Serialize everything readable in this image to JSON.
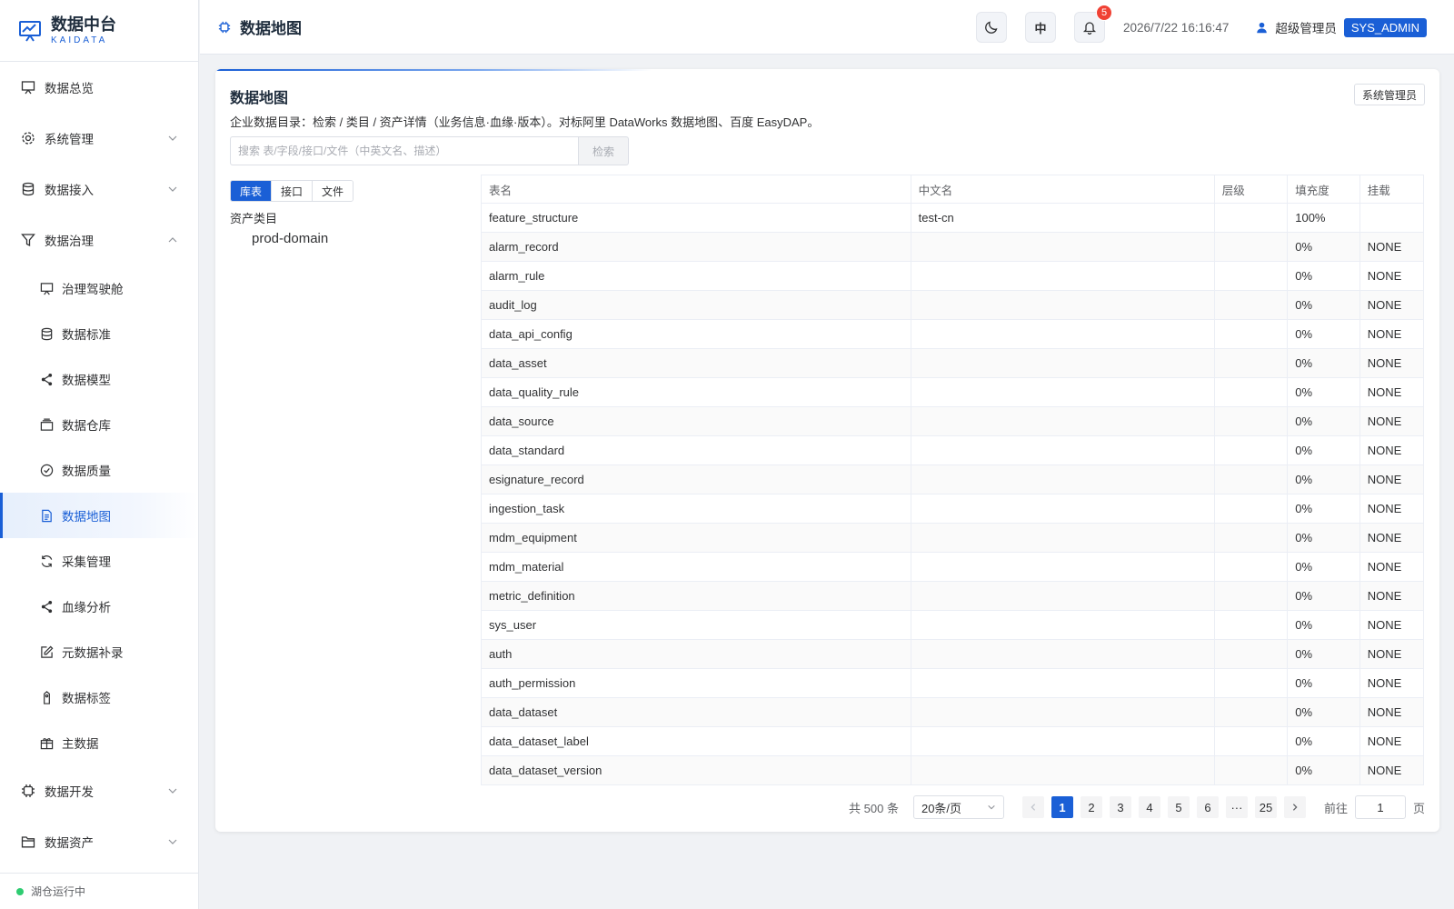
{
  "brand": {
    "title": "数据中台",
    "subtitle": "KAIDATA",
    "accent": "#1a5fd6"
  },
  "sidebar": {
    "items": [
      {
        "label": "数据总览"
      },
      {
        "label": "系统管理"
      },
      {
        "label": "数据接入"
      },
      {
        "label": "数据治理"
      }
    ],
    "sub_items": [
      {
        "label": "治理驾驶舱"
      },
      {
        "label": "数据标准"
      },
      {
        "label": "数据模型"
      },
      {
        "label": "数据仓库"
      },
      {
        "label": "数据质量"
      },
      {
        "label": "数据地图"
      },
      {
        "label": "采集管理"
      },
      {
        "label": "血缘分析"
      },
      {
        "label": "元数据补录"
      },
      {
        "label": "数据标签"
      },
      {
        "label": "主数据"
      }
    ],
    "bottom_items": [
      {
        "label": "数据开发"
      },
      {
        "label": "数据资产"
      }
    ],
    "footer_status": "湖仓运行中",
    "status_color": "#2ecc71"
  },
  "header": {
    "page_title": "数据地图",
    "lang_label": "中",
    "notification_count": "5",
    "datetime": "2026/7/22 16:16:47",
    "user_name": "超级管理员",
    "role": "SYS_ADMIN"
  },
  "card": {
    "title": "数据地图",
    "description": "企业数据目录：检索 / 类目 / 资产详情（业务信息·血缘·版本）。对标阿里 DataWorks 数据地图、百度 EasyDAP。",
    "admin_button": "系统管理员",
    "search_placeholder": "搜索 表/字段/接口/文件（中英文名、描述）",
    "search_button": "检索",
    "tabs": [
      "库表",
      "接口",
      "文件"
    ],
    "tree_title": "资产类目",
    "tree_node": "prod-domain"
  },
  "table": {
    "columns": [
      "表名",
      "中文名",
      "层级",
      "填充度",
      "挂载"
    ],
    "rows": [
      [
        "feature_structure",
        "test-cn",
        "",
        "100%",
        ""
      ],
      [
        "alarm_record",
        "",
        "",
        "0%",
        "NONE"
      ],
      [
        "alarm_rule",
        "",
        "",
        "0%",
        "NONE"
      ],
      [
        "audit_log",
        "",
        "",
        "0%",
        "NONE"
      ],
      [
        "data_api_config",
        "",
        "",
        "0%",
        "NONE"
      ],
      [
        "data_asset",
        "",
        "",
        "0%",
        "NONE"
      ],
      [
        "data_quality_rule",
        "",
        "",
        "0%",
        "NONE"
      ],
      [
        "data_source",
        "",
        "",
        "0%",
        "NONE"
      ],
      [
        "data_standard",
        "",
        "",
        "0%",
        "NONE"
      ],
      [
        "esignature_record",
        "",
        "",
        "0%",
        "NONE"
      ],
      [
        "ingestion_task",
        "",
        "",
        "0%",
        "NONE"
      ],
      [
        "mdm_equipment",
        "",
        "",
        "0%",
        "NONE"
      ],
      [
        "mdm_material",
        "",
        "",
        "0%",
        "NONE"
      ],
      [
        "metric_definition",
        "",
        "",
        "0%",
        "NONE"
      ],
      [
        "sys_user",
        "",
        "",
        "0%",
        "NONE"
      ],
      [
        "auth",
        "",
        "",
        "0%",
        "NONE"
      ],
      [
        "auth_permission",
        "",
        "",
        "0%",
        "NONE"
      ],
      [
        "data_dataset",
        "",
        "",
        "0%",
        "NONE"
      ],
      [
        "data_dataset_label",
        "",
        "",
        "0%",
        "NONE"
      ],
      [
        "data_dataset_version",
        "",
        "",
        "0%",
        "NONE"
      ]
    ]
  },
  "pagination": {
    "total": "共 500 条",
    "page_size": "20条/页",
    "pages": [
      "1",
      "2",
      "3",
      "4",
      "5",
      "6",
      "···",
      "25"
    ],
    "current": "1",
    "goto_prefix": "前往",
    "goto_value": "1",
    "goto_suffix": "页"
  }
}
